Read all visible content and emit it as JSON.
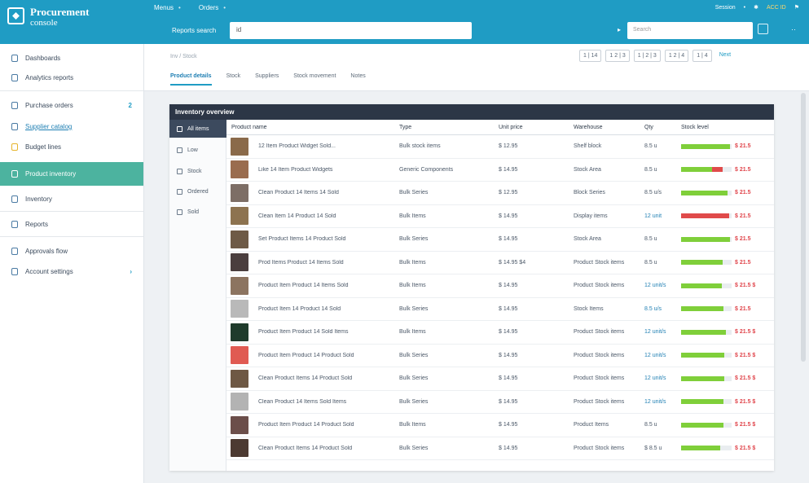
{
  "app": {
    "brand_line1": "Procurement",
    "brand_line2": "console",
    "nav": [
      {
        "label": "Menus"
      },
      {
        "label": "Orders"
      }
    ],
    "top_right": {
      "user": "Session",
      "account": "ACC ID"
    },
    "search_label": "Reports search",
    "search_value": "id",
    "filter_placeholder": "Search"
  },
  "sidebar": {
    "items": [
      {
        "label": "Dashboards",
        "icon": "dashboard-icon"
      },
      {
        "label": "Analytics reports",
        "icon": "chart-icon"
      },
      {
        "label": "Purchase orders",
        "icon": "cart-icon",
        "badge": "2"
      },
      {
        "label": "Supplier catalog",
        "icon": "catalog-icon",
        "link": true
      },
      {
        "label": "Budget lines",
        "icon": "wallet-icon"
      },
      {
        "label": "Product inventory",
        "icon": "box-icon",
        "active": true
      },
      {
        "label": "Inventory",
        "icon": "archive-icon"
      },
      {
        "label": "Reports",
        "icon": "report-icon"
      },
      {
        "label": "Approvals flow",
        "icon": "user-icon"
      },
      {
        "label": "Account settings",
        "icon": "person-icon",
        "chevron": "›"
      }
    ]
  },
  "content": {
    "breadcrumb": "Inv / Stock",
    "pager": [
      "1 | 14",
      "1 2 | 3",
      "1 | 2 | 3",
      "1 2 | 4",
      "1 | 4",
      "Next"
    ],
    "tabs": [
      {
        "label": "Product details",
        "active": true
      },
      {
        "label": "Stock"
      },
      {
        "label": "Suppliers"
      },
      {
        "label": "Stock movement"
      },
      {
        "label": "Notes"
      }
    ]
  },
  "panel": {
    "title": "Inventory overview",
    "filters": [
      {
        "label": "All items",
        "active": true
      },
      {
        "label": "Low"
      },
      {
        "label": "Stock"
      },
      {
        "label": "Ordered"
      },
      {
        "label": "Sold"
      }
    ],
    "columns": {
      "desc": "Product name",
      "cat": "Type",
      "price": "Unit price",
      "stock": "Warehouse",
      "ord": "Qty",
      "level": "Stock level"
    },
    "rows": [
      {
        "thumb": "#8a6a4a",
        "desc": "12 Item Product Widget Sold...",
        "cat": "Bulk stock items",
        "price": "$ 12.95",
        "stock": "Shelf block",
        "ord": "8.5 u",
        "level": 0.97,
        "bar_color": "#7fcf3a",
        "val": "$ 21.5",
        "ord_link": false
      },
      {
        "thumb": "#9a6c4e",
        "desc": "Like 14 Item Product Widgets",
        "cat": "Generic Components",
        "price": "$ 14.95",
        "stock": "Stock Area",
        "ord": "8.5 u",
        "level": 0.82,
        "bar_color": "#7fcf3a",
        "val": "$ 21.5",
        "ord_link": false,
        "tail_red": true
      },
      {
        "thumb": "#7d6e66",
        "desc": "Clean Product 14 Items 14 Sold",
        "cat": "Bulk Series",
        "price": "$ 12.95",
        "stock": "Block Series",
        "ord": "8.5 u/s",
        "level": 0.92,
        "bar_color": "#7fcf3a",
        "val": "$ 21.5",
        "ord_link": false
      },
      {
        "thumb": "#8d7350",
        "desc": "Clean Item 14 Product 14 Sold",
        "cat": "Bulk Items",
        "price": "$ 14.95",
        "stock": "Display items",
        "ord": "12 unit",
        "level": 0.95,
        "bar_color": "#e04a4a",
        "val": "$ 21.5",
        "ord_link": true
      },
      {
        "thumb": "#6e5a46",
        "desc": "Set Product Items 14 Product Sold",
        "cat": "Bulk Series",
        "price": "$ 14.95",
        "stock": "Stock Area",
        "ord": "8.5 u",
        "level": 0.97,
        "bar_color": "#7fcf3a",
        "val": "$ 21.5",
        "ord_link": false
      },
      {
        "thumb": "#4a3e3e",
        "desc": "Prod Items Product 14 Items Sold",
        "cat": "Bulk Items",
        "price": "$ 14.95 $4",
        "stock": "Product Stock items",
        "ord": "8.5 u",
        "level": 0.82,
        "bar_color": "#7fcf3a",
        "val": "$ 21.5",
        "ord_link": false
      },
      {
        "thumb": "#8c7460",
        "desc": "Product Item Product 14 Items Sold",
        "cat": "Bulk Items",
        "price": "$ 14.95",
        "stock": "Product Stock items",
        "ord": "12 unit/s",
        "level": 0.8,
        "bar_color": "#7fcf3a",
        "val": "$ 21.5 $",
        "ord_link": true
      },
      {
        "thumb": "#b9b9b9",
        "desc": "Product Item 14 Product 14 Sold",
        "cat": "Bulk Series",
        "price": "$ 14.95",
        "stock": "Stock Items",
        "ord": "8.5 u/s",
        "level": 0.84,
        "bar_color": "#7fcf3a",
        "val": "$ 21.5",
        "ord_link": true
      },
      {
        "thumb": "#1f3b2c",
        "desc": "Product Item Product 14 Sold Items",
        "cat": "Bulk Items",
        "price": "$ 14.95",
        "stock": "Product Stock items",
        "ord": "12 unit/s",
        "level": 0.88,
        "bar_color": "#7fcf3a",
        "val": "$ 21.5 $",
        "ord_link": true
      },
      {
        "thumb": "#e05a52",
        "desc": "Product Item Product 14 Product Sold",
        "cat": "Bulk Series",
        "price": "$ 14.95",
        "stock": "Product Stock items",
        "ord": "12 unit/s",
        "level": 0.86,
        "bar_color": "#7fcf3a",
        "val": "$ 21.5 $",
        "ord_link": true
      },
      {
        "thumb": "#6e5844",
        "desc": "Clean Product Items 14 Product Sold",
        "cat": "Bulk Series",
        "price": "$ 14.95",
        "stock": "Product Stock items",
        "ord": "12 unit/s",
        "level": 0.85,
        "bar_color": "#7fcf3a",
        "val": "$ 21.5 $",
        "ord_link": true
      },
      {
        "thumb": "#b3b3b3",
        "desc": "Clean Product 14 Items Sold Items",
        "cat": "Bulk Series",
        "price": "$ 14.95",
        "stock": "Product Stock items",
        "ord": "12 unit/s",
        "level": 0.84,
        "bar_color": "#7fcf3a",
        "val": "$ 21.5 $",
        "ord_link": true
      },
      {
        "thumb": "#6b4e4a",
        "desc": "Product Item Product 14 Product Sold",
        "cat": "Bulk Items",
        "price": "$ 14.95",
        "stock": "Product Items",
        "ord": "8.5 u",
        "level": 0.84,
        "bar_color": "#7fcf3a",
        "val": "$ 21.5 $",
        "ord_link": false
      },
      {
        "thumb": "#4c3a32",
        "desc": "Clean Product Items 14 Product Sold",
        "cat": "Bulk Series",
        "price": "$ 14.95",
        "stock": "Product Stock items",
        "ord": "$ 8.5 u",
        "level": 0.78,
        "bar_color": "#7fcf3a",
        "val": "$ 21.5 $",
        "ord_link": false
      }
    ]
  },
  "colors": {
    "topbar": "#1f9cc4",
    "sidebar_active": "#4cb39f",
    "panel_head": "#2c3646",
    "bar_good": "#7fcf3a",
    "bar_alert": "#e04a4a",
    "value_red": "#e0454b"
  }
}
